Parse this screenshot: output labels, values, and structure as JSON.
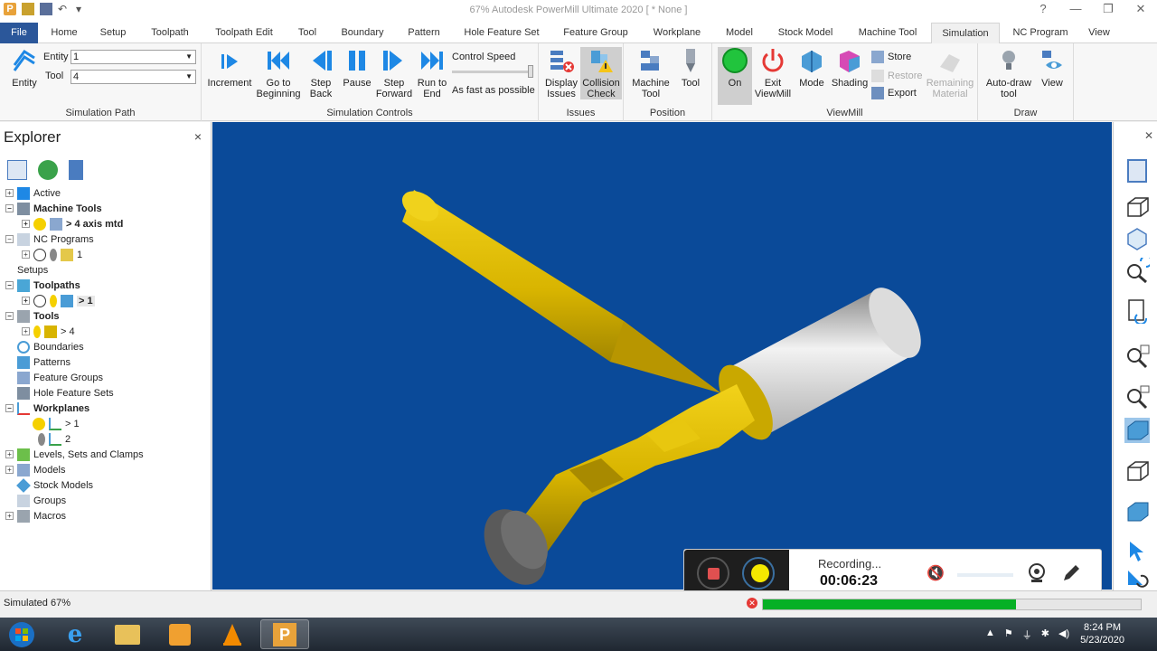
{
  "window": {
    "title": "67% Autodesk PowerMill Ultimate 2020    [ * None ]",
    "app_icon_letter": "P",
    "controls": [
      "?",
      "—",
      "❐",
      "✕"
    ]
  },
  "tabs": [
    "File",
    "Home",
    "Setup",
    "Toolpath",
    "Toolpath Edit",
    "Tool",
    "Boundary",
    "Pattern",
    "Hole Feature Set",
    "Feature Group",
    "Workplane",
    "Model",
    "Stock Model",
    "Machine Tool",
    "Simulation",
    "NC Program",
    "View"
  ],
  "active_tab": "Simulation",
  "ribbon": {
    "simulation_path": {
      "entity_button": "Entity",
      "entity_label": "Entity",
      "entity_value": "1",
      "tool_label": "Tool",
      "tool_value": "4",
      "group_label": "Simulation Path"
    },
    "simulation_controls": {
      "increment": "Increment",
      "go_to_beginning": "Go to Beginning",
      "step_back": "Step Back",
      "pause": "Pause",
      "step_forward": "Step Forward",
      "run_to_end": "Run to End",
      "control_speed": "Control Speed",
      "as_fast": "As fast as possible",
      "group_label": "Simulation Controls"
    },
    "issues": {
      "display_issues": "Display Issues",
      "collision_check": "Collision Check",
      "group_label": "Issues"
    },
    "position": {
      "machine_tool": "Machine Tool",
      "tool": "Tool",
      "group_label": "Position"
    },
    "viewmill": {
      "on": "On",
      "exit": "Exit ViewMill",
      "mode": "Mode",
      "shading": "Shading",
      "store": "Store",
      "restore": "Restore",
      "export": "Export",
      "remaining_material": "Remaining Material",
      "group_label": "ViewMill"
    },
    "draw": {
      "auto_draw": "Auto-draw tool",
      "view": "View",
      "group_label": "Draw"
    }
  },
  "explorer": {
    "title": "Explorer",
    "close": "×",
    "tree": [
      {
        "label": "Active",
        "bold": false
      },
      {
        "label": "Machine Tools",
        "bold": true
      },
      {
        "label": "> 4 axis mtd",
        "bold": true
      },
      {
        "label": "NC Programs",
        "bold": false
      },
      {
        "label": "1",
        "bold": false
      },
      {
        "label": "Setups",
        "bold": false
      },
      {
        "label": "Toolpaths",
        "bold": true
      },
      {
        "label": "> 1",
        "bold": true
      },
      {
        "label": "Tools",
        "bold": true
      },
      {
        "label": "> 4",
        "bold": false
      },
      {
        "label": "Boundaries",
        "bold": false
      },
      {
        "label": "Patterns",
        "bold": false
      },
      {
        "label": "Feature Groups",
        "bold": false
      },
      {
        "label": "Hole Feature Sets",
        "bold": false
      },
      {
        "label": "Workplanes",
        "bold": true
      },
      {
        "label": "> 1",
        "bold": false
      },
      {
        "label": "2",
        "bold": false
      },
      {
        "label": "Levels, Sets and Clamps",
        "bold": false
      },
      {
        "label": "Models",
        "bold": false
      },
      {
        "label": "Stock Models",
        "bold": false
      },
      {
        "label": "Groups",
        "bold": false
      },
      {
        "label": "Macros",
        "bold": false
      }
    ]
  },
  "recording": {
    "label": "Recording...",
    "time": "00:06:23"
  },
  "status": {
    "text": "Simulated 67%",
    "progress": 0.67
  },
  "taskbar": {
    "time": "8:24 PM",
    "date": "5/23/2020"
  },
  "colors": {
    "viewport_bg": "#0a4a99",
    "tool_gold": "#d8b400",
    "file_tab": "#2b579a",
    "progress": "#06b025",
    "ribbon_blue": "#1e88e5"
  }
}
